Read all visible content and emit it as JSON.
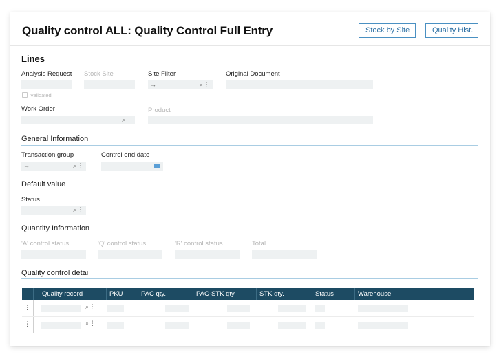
{
  "header": {
    "title": "Quality control ALL: Quality Control Full Entry",
    "buttons": {
      "stock_by_site": "Stock by Site",
      "quality_hist": "Quality Hist."
    }
  },
  "lines": {
    "title": "Lines",
    "analysis_request": {
      "label": "Analysis Request",
      "value": ""
    },
    "stock_site": {
      "label": "Stock Site",
      "value": ""
    },
    "site_filter": {
      "label": "Site Filter",
      "value": "",
      "prefix_icon": "→"
    },
    "original_document": {
      "label": "Original Document",
      "value": ""
    },
    "validated": {
      "label": "Validated",
      "checked": false
    },
    "work_order": {
      "label": "Work Order",
      "value": ""
    },
    "product": {
      "label": "Product",
      "value": ""
    }
  },
  "general_information": {
    "title": "General Information",
    "transaction_group": {
      "label": "Transaction group",
      "value": "",
      "prefix_icon": "→"
    },
    "control_end_date": {
      "label": "Control end date",
      "value": ""
    }
  },
  "default_value": {
    "title": "Default value",
    "status": {
      "label": "Status",
      "value": ""
    }
  },
  "quantity_information": {
    "title": "Quantity Information",
    "a_control_status": {
      "label": "'A' control status",
      "value": ""
    },
    "q_control_status": {
      "label": "'Q' control status",
      "value": ""
    },
    "r_control_status": {
      "label": "'R' control status",
      "value": ""
    },
    "total": {
      "label": "Total",
      "value": ""
    }
  },
  "quality_control_detail": {
    "title": "Quality control detail",
    "columns": [
      "Quality record",
      "PKU",
      "PAC qty.",
      "PAC-STK qty.",
      "STK qty.",
      "Status",
      "Warehouse"
    ],
    "rows": [
      {
        "quality_record": "",
        "pku": "",
        "pac_qty": "",
        "pac_stk_qty": "",
        "stk_qty": "",
        "status": "",
        "warehouse": ""
      },
      {
        "quality_record": "",
        "pku": "",
        "pac_qty": "",
        "pac_stk_qty": "",
        "stk_qty": "",
        "status": "",
        "warehouse": ""
      }
    ]
  },
  "icons": {
    "lookup": "🔍︎",
    "more": "⋮",
    "arrow": "→"
  }
}
